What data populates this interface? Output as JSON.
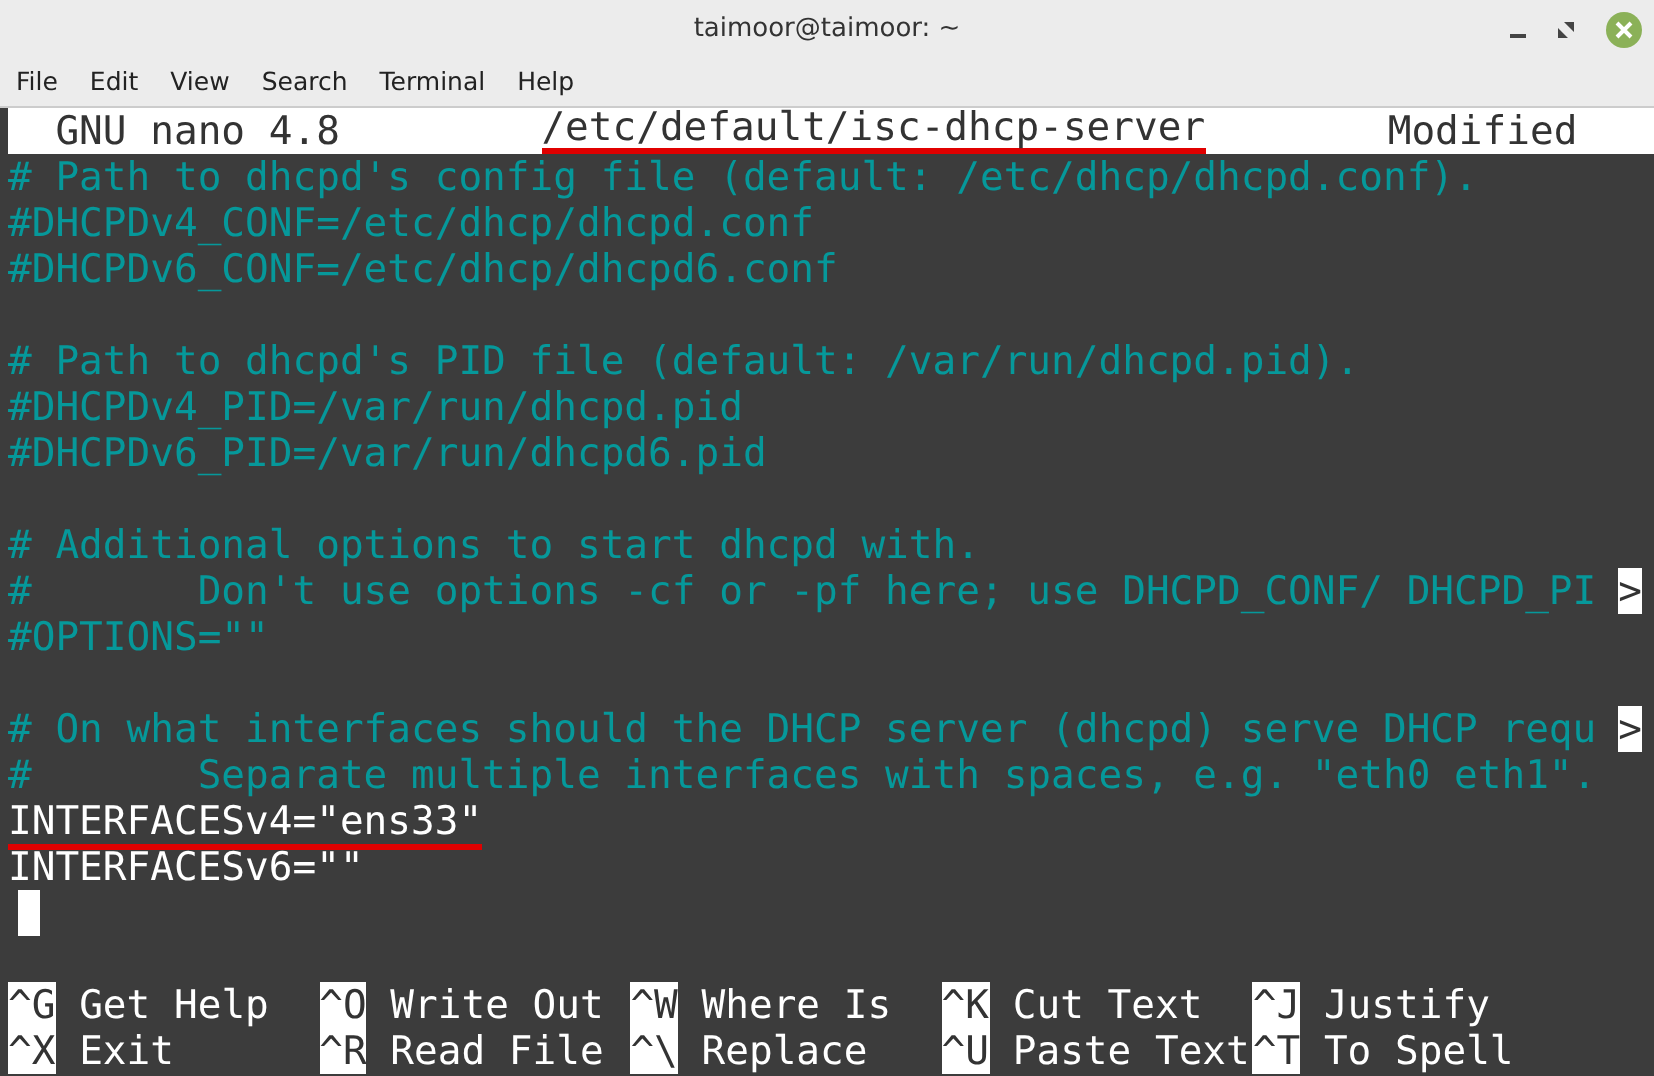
{
  "window": {
    "title": "taimoor@taimoor: ~"
  },
  "menu": [
    "File",
    "Edit",
    "View",
    "Search",
    "Terminal",
    "Help"
  ],
  "nano_header": {
    "version": "GNU nano 4.8",
    "filename": "/etc/default/isc-dhcp-server",
    "filename_underlined": true,
    "status": "Modified"
  },
  "lines": [
    {
      "kind": "comment",
      "text": "# Path to dhcpd's config file (default: /etc/dhcp/dhcpd.conf).",
      "underlined": false
    },
    {
      "kind": "comment",
      "text": "#DHCPDv4_CONF=/etc/dhcp/dhcpd.conf",
      "underlined": false
    },
    {
      "kind": "comment",
      "text": "#DHCPDv6_CONF=/etc/dhcp/dhcpd6.conf",
      "underlined": false
    },
    {
      "kind": "blank"
    },
    {
      "kind": "comment",
      "text": "# Path to dhcpd's PID file (default: /var/run/dhcpd.pid).",
      "underlined": false
    },
    {
      "kind": "comment",
      "text": "#DHCPDv4_PID=/var/run/dhcpd.pid",
      "underlined": false
    },
    {
      "kind": "comment",
      "text": "#DHCPDv6_PID=/var/run/dhcpd6.pid",
      "underlined": false
    },
    {
      "kind": "blank"
    },
    {
      "kind": "comment",
      "text": "# Additional options to start dhcpd with.",
      "underlined": false
    },
    {
      "kind": "comment",
      "text": "#       Don't use options -cf or -pf here; use DHCPD_CONF/ DHCPD_PI",
      "overflow_mark": ">",
      "underlined": false
    },
    {
      "kind": "comment",
      "text": "#OPTIONS=\"\"",
      "underlined": false
    },
    {
      "kind": "blank"
    },
    {
      "kind": "comment",
      "text": "# On what interfaces should the DHCP server (dhcpd) serve DHCP requ",
      "overflow_mark": ">",
      "underlined": false
    },
    {
      "kind": "comment",
      "text": "#       Separate multiple interfaces with spaces, e.g. \"eth0 eth1\".",
      "underlined": false
    },
    {
      "kind": "code",
      "text": "INTERFACESv4=\"ens33\"",
      "underlined": true
    },
    {
      "kind": "code",
      "text": "INTERFACESv6=\"\"",
      "underlined": false
    },
    {
      "kind": "cursor"
    },
    {
      "kind": "blank"
    }
  ],
  "shortcuts": [
    [
      {
        "key": "^G",
        "label": "Get Help"
      },
      {
        "key": "^O",
        "label": "Write Out"
      },
      {
        "key": "^W",
        "label": "Where Is"
      },
      {
        "key": "^K",
        "label": "Cut Text"
      },
      {
        "key": "^J",
        "label": "Justify"
      }
    ],
    [
      {
        "key": "^X",
        "label": "Exit"
      },
      {
        "key": "^R",
        "label": "Read File"
      },
      {
        "key": "^\\",
        "label": "Replace"
      },
      {
        "key": "^U",
        "label": "Paste Text"
      },
      {
        "key": "^T",
        "label": "To Spell"
      }
    ]
  ]
}
